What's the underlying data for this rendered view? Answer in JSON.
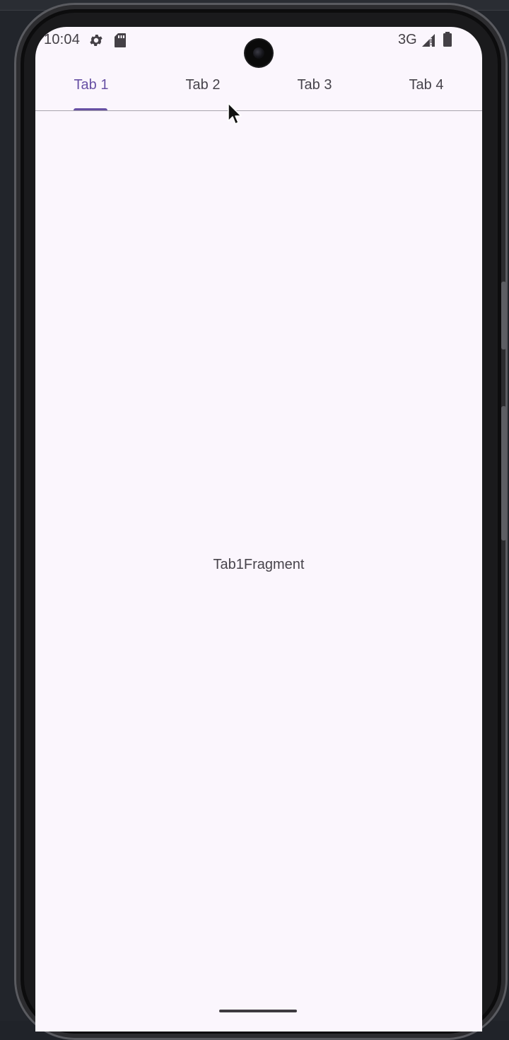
{
  "status_bar": {
    "time": "10:04",
    "network": "3G",
    "icons": [
      "settings-icon",
      "sd-card-icon",
      "signal-icon",
      "battery-icon"
    ]
  },
  "tabs": [
    {
      "label": "Tab 1",
      "selected": true
    },
    {
      "label": "Tab 2",
      "selected": false
    },
    {
      "label": "Tab 3",
      "selected": false
    },
    {
      "label": "Tab 4",
      "selected": false
    }
  ],
  "content": {
    "text": "Tab1Fragment"
  },
  "colors": {
    "accent": "#6750a4",
    "background": "#fbf6fd",
    "text": "#46434b"
  }
}
